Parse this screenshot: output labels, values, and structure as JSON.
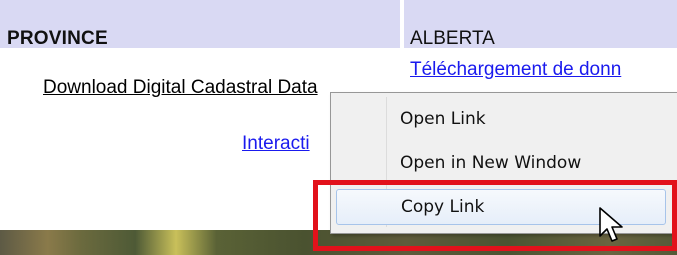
{
  "table": {
    "province_label": "PROVINCE",
    "province_value": "ALBERTA"
  },
  "links": {
    "download_en": "Download Digital Cadastral Data",
    "download_fr": "Téléchargement de donn",
    "interactive": "Interacti"
  },
  "context_menu": {
    "items": [
      {
        "label": "Open Link"
      },
      {
        "label": "Open in New Window"
      },
      {
        "label": "Copy Link"
      }
    ]
  },
  "colors": {
    "highlight": "#e2111b",
    "link": "#1a1aee",
    "header_bg": "#d9d9f3"
  },
  "icons": {
    "cursor": "arrow-pointer-icon"
  }
}
